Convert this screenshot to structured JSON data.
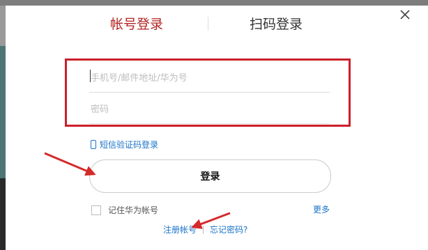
{
  "tabs": {
    "account_login": "帐号登录",
    "qr_login": "扫码登录"
  },
  "form": {
    "phone_placeholder": "手机号/邮件地址/华为号",
    "password_placeholder": "密码"
  },
  "sms_login_label": "短信验证码登录",
  "login_button_label": "登录",
  "remember_label": "记住华为帐号",
  "more_label": "更多",
  "footer": {
    "register_label": "注册帐号",
    "forgot_label": "忘记密码?"
  },
  "colors": {
    "active_tab": "#b22222",
    "link": "#1a73c9",
    "annotation": "#cc1f2a"
  },
  "icons": {
    "close": "close-icon",
    "phone": "mobile-phone-icon"
  }
}
